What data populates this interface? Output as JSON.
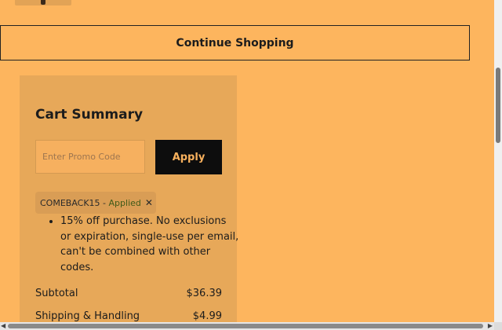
{
  "continue_button": {
    "label": "Continue Shopping"
  },
  "summary": {
    "title": "Cart Summary",
    "promo": {
      "placeholder": "Enter Promo Code",
      "value": ""
    },
    "apply_label": "Apply",
    "coupon": {
      "code": "COMEBACK15",
      "separator": " - ",
      "status": "Applied",
      "remove_glyph": "✕",
      "description": "15% off purchase. No exclusions or expiration, single-use per email, can't be combined with other codes."
    },
    "rows": [
      {
        "label": "Subtotal",
        "value": "$36.39"
      },
      {
        "label": "Shipping & Handling",
        "value": "$4.99"
      }
    ]
  },
  "scrollbars": {
    "left_arrow": "◀",
    "right_arrow": "▶"
  },
  "colors": {
    "page_bg": "#fdb55e",
    "panel_bg": "#e7a859",
    "apply_bg": "#0d0d0d",
    "apply_text": "#f8b15d",
    "applied_text": "#3f5a18"
  }
}
